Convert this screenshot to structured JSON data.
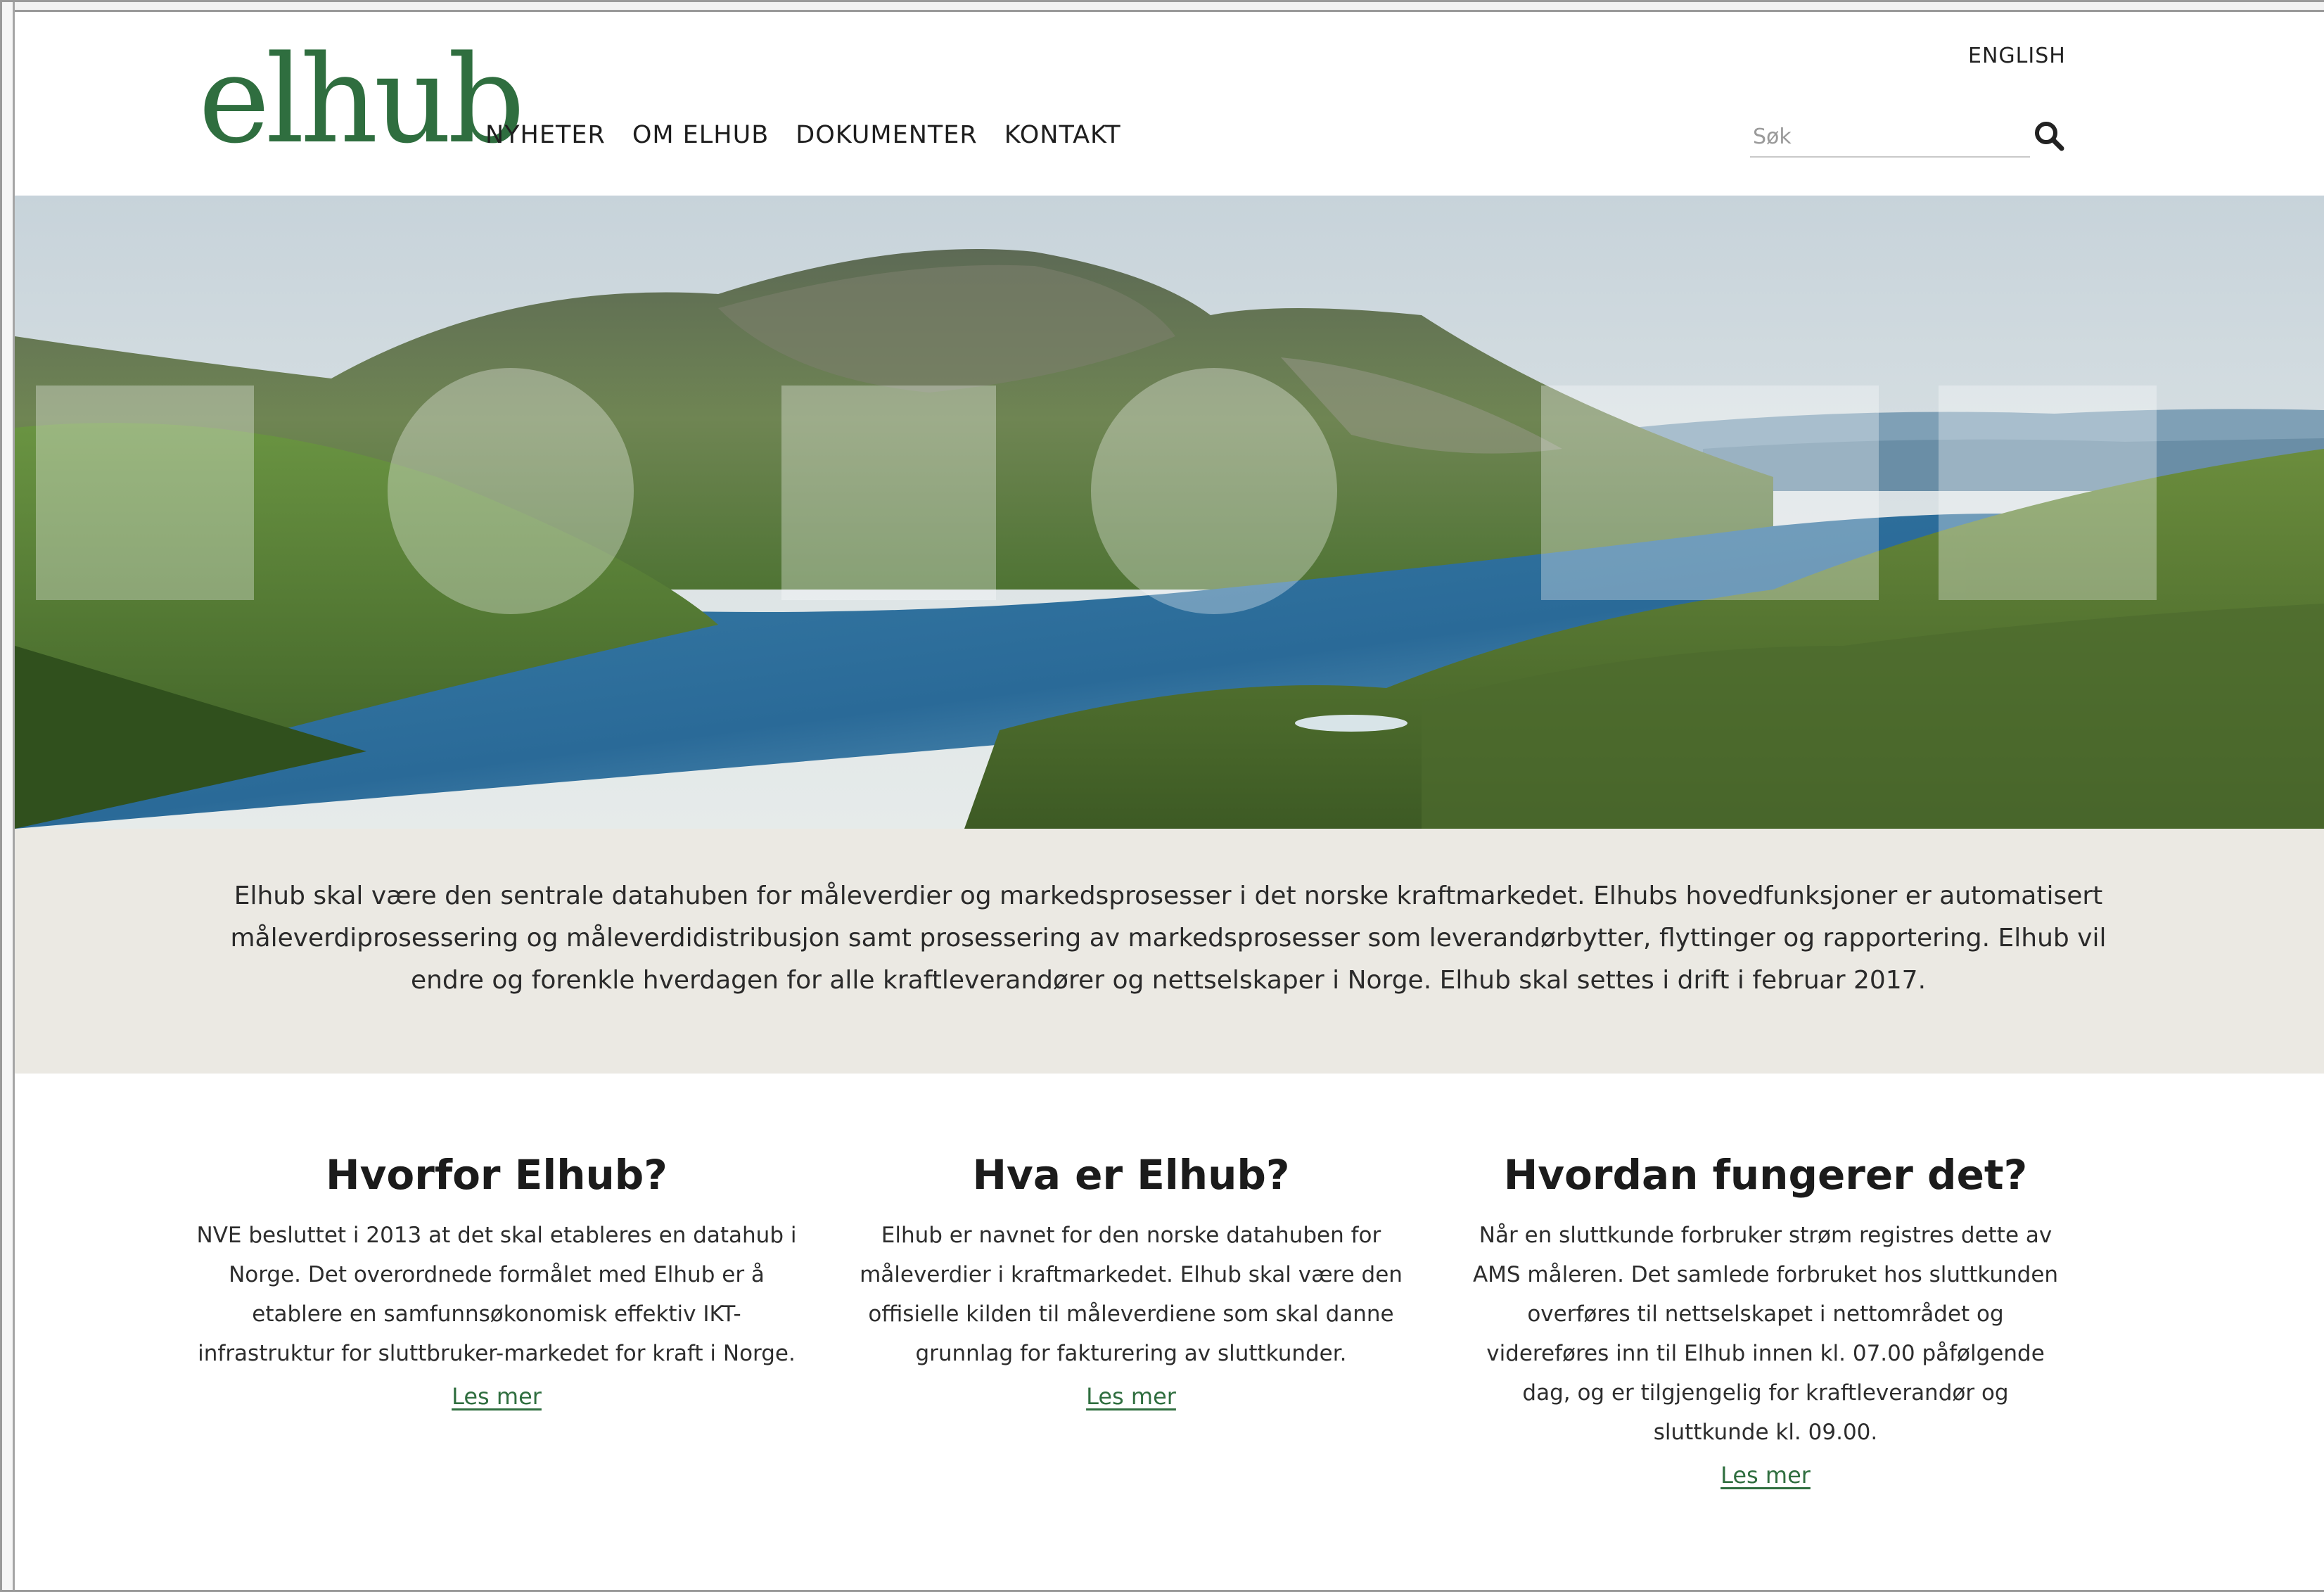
{
  "header": {
    "logo": "elhub",
    "nav": [
      "NYHETER",
      "OM ELHUB",
      "DOKUMENTER",
      "KONTAKT"
    ],
    "language_link": "ENGLISH",
    "search": {
      "placeholder": "Søk",
      "icon": "search-icon"
    }
  },
  "hero": {
    "image": "mountain-lake-landscape"
  },
  "intro": {
    "text": "Elhub skal være den sentrale datahuben for måleverdier og markedsprosesser i det norske kraftmarkedet. Elhubs hovedfunksjoner er automatisert måleverdiprosessering og måleverdidistribusjon samt prosessering av markedsprosesser som leverandørbytter, flyttinger og rapportering. Elhub vil endre og forenkle hverdagen for alle kraftleverandører og nettselskaper i Norge. Elhub skal settes i drift i februar 2017."
  },
  "columns": [
    {
      "title": "Hvorfor Elhub?",
      "body": "NVE besluttet i 2013 at det skal etableres en datahub i Norge. Det overordnede formålet med Elhub er å etablere en samfunnsøkonomisk effektiv IKT-infrastruktur for sluttbruker-markedet for kraft i Norge.",
      "link": "Les mer"
    },
    {
      "title": "Hva er Elhub?",
      "body": "Elhub er navnet for den norske datahuben for måleverdier i kraftmarkedet. Elhub skal være den offisielle kilden til måleverdiene som skal danne grunnlag for fakturering av sluttkunder.",
      "link": "Les mer"
    },
    {
      "title": "Hvordan fungerer det?",
      "body": "Når en sluttkunde forbruker strøm registres dette av AMS måleren. Det samlede forbruket hos sluttkunden overføres til nettselskapet i nettområdet og videreføres inn til Elhub innen kl. 07.00 påfølgende dag, og er tilgjengelig for kraftleverandør og sluttkunde kl. 09.00.",
      "link": "Les mer"
    }
  ],
  "colors": {
    "brand_green": "#2f6e3f",
    "intro_background": "#ebe9e3"
  }
}
